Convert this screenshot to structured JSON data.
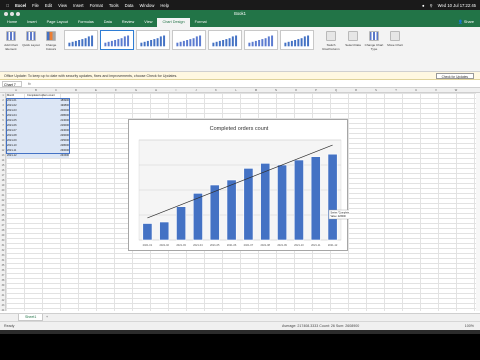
{
  "menubar": {
    "app": "Excel",
    "items": [
      "File",
      "Edit",
      "View",
      "Insert",
      "Format",
      "Tools",
      "Data",
      "Window",
      "Help"
    ],
    "clock": "Wed 10 Jul 17:22:45"
  },
  "window": {
    "title": "Book1"
  },
  "ribbon_tabs": [
    "Home",
    "Insert",
    "Page Layout",
    "Formulas",
    "Data",
    "Review",
    "View",
    "Chart Design",
    "Format"
  ],
  "active_tab": "Chart Design",
  "share_label": "Share",
  "ribbon": {
    "add_chart_element": "Add Chart Element",
    "quick_layout": "Quick Layout",
    "change_colours": "Change Colours",
    "switch_row_col": "Switch Row/Column",
    "select_data": "Select Data",
    "change_chart_type": "Change Chart Type",
    "move_chart": "Move Chart"
  },
  "notification": {
    "text": "Office Update: To keep up to date with security updates, fixes and improvements, choose Check for Updates.",
    "button": "Check for Updates"
  },
  "formula_bar": {
    "name_box": "Chart 7",
    "fx": "fx"
  },
  "columns": [
    "A",
    "B",
    "C",
    "D",
    "E",
    "F",
    "G",
    "H",
    "I",
    "J",
    "K",
    "L",
    "M",
    "N",
    "O",
    "P",
    "Q",
    "R",
    "S",
    "T",
    "U",
    "V",
    "W"
  ],
  "rows_count": 44,
  "table": {
    "header": [
      "Month",
      "Completed orders count"
    ],
    "rows": [
      [
        "2021-01",
        "189900"
      ],
      [
        "2021-02",
        "190800"
      ],
      [
        "2021-03",
        "200000"
      ],
      [
        "2021-04",
        "208000"
      ],
      [
        "2021-05",
        "213000"
      ],
      [
        "2021-06",
        "216000"
      ],
      [
        "2021-07",
        "223000"
      ],
      [
        "2021-08",
        "226000"
      ],
      [
        "2021-09",
        "225000"
      ],
      [
        "2021-10",
        "228000"
      ],
      [
        "2021-11",
        "230000"
      ],
      [
        "2021-12",
        "231500"
      ]
    ]
  },
  "tooltip": {
    "line1": "Series \"Completed orders count\" Point \"2021-07\"",
    "line2": "Value: 223000"
  },
  "chart_data": {
    "type": "bar",
    "title": "Completed orders count",
    "categories": [
      "2021-01",
      "2021-02",
      "2021-03",
      "2021-04",
      "2021-05",
      "2021-06",
      "2021-07",
      "2021-08",
      "2021-09",
      "2021-10",
      "2021-11",
      "2021-12"
    ],
    "series": [
      {
        "name": "Completed orders count",
        "values": [
          189900,
          190800,
          200000,
          208000,
          213000,
          216000,
          223000,
          226000,
          225000,
          228000,
          230000,
          231500
        ]
      }
    ],
    "trendline": "linear",
    "ylim": [
      180000,
      240000
    ],
    "grid": true,
    "legend": "none",
    "colors": {
      "bar": "#4472c4",
      "trend": "#2f2f2f"
    }
  },
  "sheet_tabs": [
    "Sheet1"
  ],
  "status": {
    "left": "Ready",
    "stats": "Average: 217408.3333   Count: 26   Sum: 2608900",
    "zoom": "100%"
  }
}
